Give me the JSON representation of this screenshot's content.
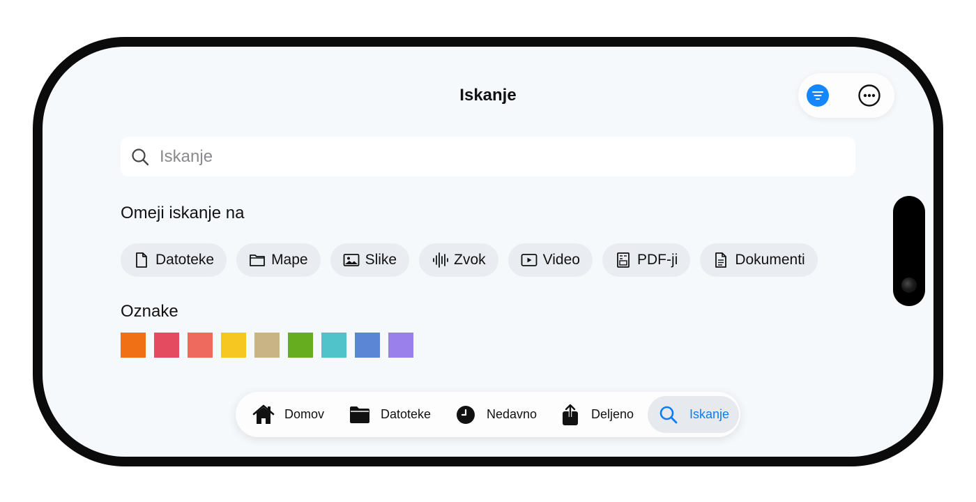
{
  "header": {
    "title": "Iskanje"
  },
  "top_actions": {
    "filter_icon": "filter-icon",
    "more_icon": "ellipsis-circle-icon",
    "accent": "#1487ff"
  },
  "search": {
    "placeholder": "Iskanje",
    "value": ""
  },
  "limit_section": {
    "label": "Omeji iskanje na",
    "chips": [
      {
        "label": "Datoteke",
        "icon": "file-icon"
      },
      {
        "label": "Mape",
        "icon": "folder-icon"
      },
      {
        "label": "Slike",
        "icon": "image-icon"
      },
      {
        "label": "Zvok",
        "icon": "waveform-icon"
      },
      {
        "label": "Video",
        "icon": "video-icon"
      },
      {
        "label": "PDF-ji",
        "icon": "pdf-icon"
      },
      {
        "label": "Dokumenti",
        "icon": "document-icon"
      }
    ]
  },
  "tags_section": {
    "label": "Oznake",
    "colors": [
      "#f07015",
      "#e44a60",
      "#ee6a5e",
      "#f6c720",
      "#c9b485",
      "#66ae1f",
      "#4fc3c9",
      "#5b86d5",
      "#9a80ea"
    ]
  },
  "tabbar": {
    "active_color": "#0a7cf5",
    "items": [
      {
        "label": "Domov",
        "icon": "home-icon"
      },
      {
        "label": "Datoteke",
        "icon": "folder-filled-icon"
      },
      {
        "label": "Nedavno",
        "icon": "clock-icon"
      },
      {
        "label": "Deljeno",
        "icon": "share-icon"
      },
      {
        "label": "Iskanje",
        "icon": "search-icon",
        "active": true
      }
    ]
  }
}
